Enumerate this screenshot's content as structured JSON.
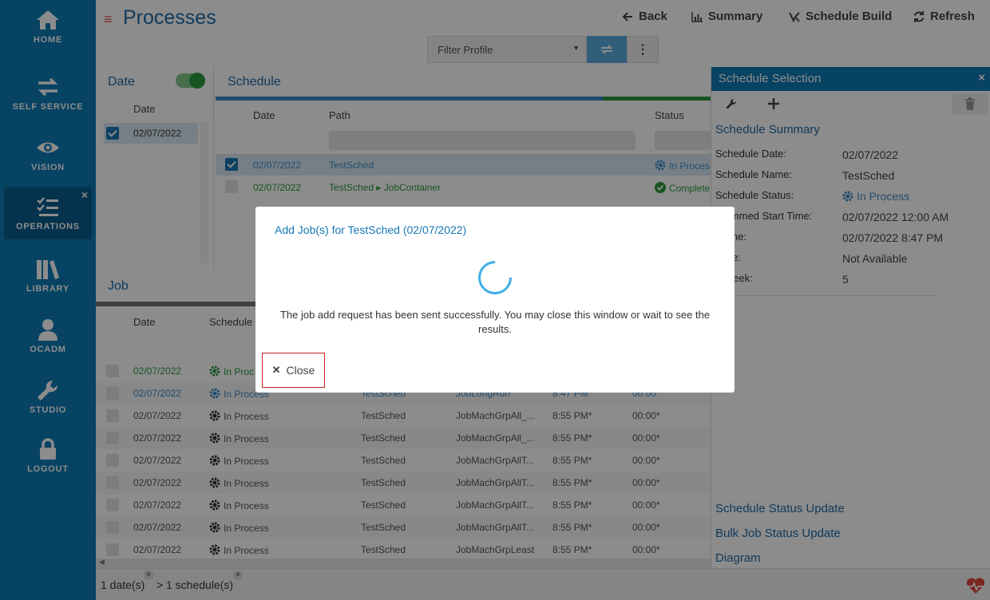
{
  "sidebar": {
    "items": [
      {
        "label": "HOME",
        "icon": "home-icon"
      },
      {
        "label": "SELF SERVICE",
        "icon": "swap-arrows-icon"
      },
      {
        "label": "VISION",
        "icon": "eye-icon"
      },
      {
        "label": "OPERATIONS",
        "icon": "checklist-icon"
      },
      {
        "label": "LIBRARY",
        "icon": "books-icon"
      },
      {
        "label": "OCADM",
        "icon": "user-icon"
      },
      {
        "label": "STUDIO",
        "icon": "wrench-icon"
      },
      {
        "label": "LOGOUT",
        "icon": "lock-icon"
      }
    ],
    "close_glyph": "×"
  },
  "header": {
    "menu_glyph": "≡",
    "title": "Processes",
    "back": "Back",
    "summary": "Summary",
    "schedule_build": "Schedule Build",
    "refresh": "Refresh",
    "filter_placeholder": "Filter Profile",
    "more_glyph": "⋮"
  },
  "date_panel": {
    "title": "Date",
    "col_date": "Date",
    "rows": [
      {
        "date": "02/07/2022"
      }
    ]
  },
  "schedule_panel": {
    "title": "Schedule",
    "cols": {
      "date": "Date",
      "path": "Path",
      "status": "Status"
    },
    "rows": [
      {
        "date": "02/07/2022",
        "path": "TestSched",
        "status": "In Proces"
      },
      {
        "date": "02/07/2022",
        "path": "TestSched ▸ JobContainer",
        "status": "Complete"
      }
    ]
  },
  "job_panel": {
    "title": "Job",
    "cols": {
      "date": "Date",
      "schedule": "Schedule S"
    },
    "rows": [
      {
        "date": "02/07/2022",
        "status": "In Proc",
        "sched": "",
        "job": "",
        "time": "",
        "dur": ""
      },
      {
        "date": "02/07/2022",
        "status": "In Process",
        "sched": "TestSched",
        "job": "JobLongRun",
        "time": "8:47 PM",
        "dur": "00:00"
      },
      {
        "date": "02/07/2022",
        "status": "In Process",
        "sched": "TestSched",
        "job": "JobMachGrpAll_...",
        "time": "8:55 PM*",
        "dur": "00:00*"
      },
      {
        "date": "02/07/2022",
        "status": "In Process",
        "sched": "TestSched",
        "job": "JobMachGrpAll_...",
        "time": "8:55 PM*",
        "dur": "00:00*"
      },
      {
        "date": "02/07/2022",
        "status": "In Process",
        "sched": "TestSched",
        "job": "JobMachGrpAllT...",
        "time": "8:55 PM*",
        "dur": "00:00*"
      },
      {
        "date": "02/07/2022",
        "status": "In Process",
        "sched": "TestSched",
        "job": "JobMachGrpAllT...",
        "time": "8:55 PM*",
        "dur": "00:00*"
      },
      {
        "date": "02/07/2022",
        "status": "In Process",
        "sched": "TestSched",
        "job": "JobMachGrpAllT...",
        "time": "8:55 PM*",
        "dur": "00:00*"
      },
      {
        "date": "02/07/2022",
        "status": "In Process",
        "sched": "TestSched",
        "job": "JobMachGrpAllT...",
        "time": "8:55 PM*",
        "dur": "00:00*"
      },
      {
        "date": "02/07/2022",
        "status": "In Process",
        "sched": "TestSched",
        "job": "JobMachGrpLeast",
        "time": "8:55 PM*",
        "dur": "00:00*"
      }
    ]
  },
  "right_panel": {
    "title": "Schedule Selection",
    "close_glyph": "×",
    "summary_title": "Schedule Summary",
    "fields": [
      {
        "k": "Schedule Date:",
        "v": "02/07/2022"
      },
      {
        "k": "Schedule Name:",
        "v": "TestSched"
      },
      {
        "k": "Schedule Status:",
        "v": "In Process"
      },
      {
        "k": "grammed Start Time:",
        "v": "02/07/2022 12:00 AM"
      },
      {
        "k": "t Time:",
        "v": "02/07/2022 8:47 PM"
      },
      {
        "k": "Time:",
        "v": "Not Available"
      },
      {
        "k": "k Week:",
        "v": "5"
      }
    ],
    "accordion": [
      "Schedule Status Update",
      "Bulk Job Status Update",
      "Diagram"
    ]
  },
  "modal": {
    "title": "Add Job(s) for TestSched (02/07/2022)",
    "message": "The job add request has been sent successfully. You may close this window or wait to see the results.",
    "close_label": "Close",
    "close_glyph": "✕"
  },
  "footer": {
    "dates": "1 date(s)",
    "separator": ">",
    "schedules": "1 schedule(s)",
    "x_glyph": "×"
  },
  "colors": {
    "sidebar": "#0d7bb5",
    "accent": "#1f6aa6",
    "success": "#2b9a3d",
    "danger": "#c91f1f"
  }
}
